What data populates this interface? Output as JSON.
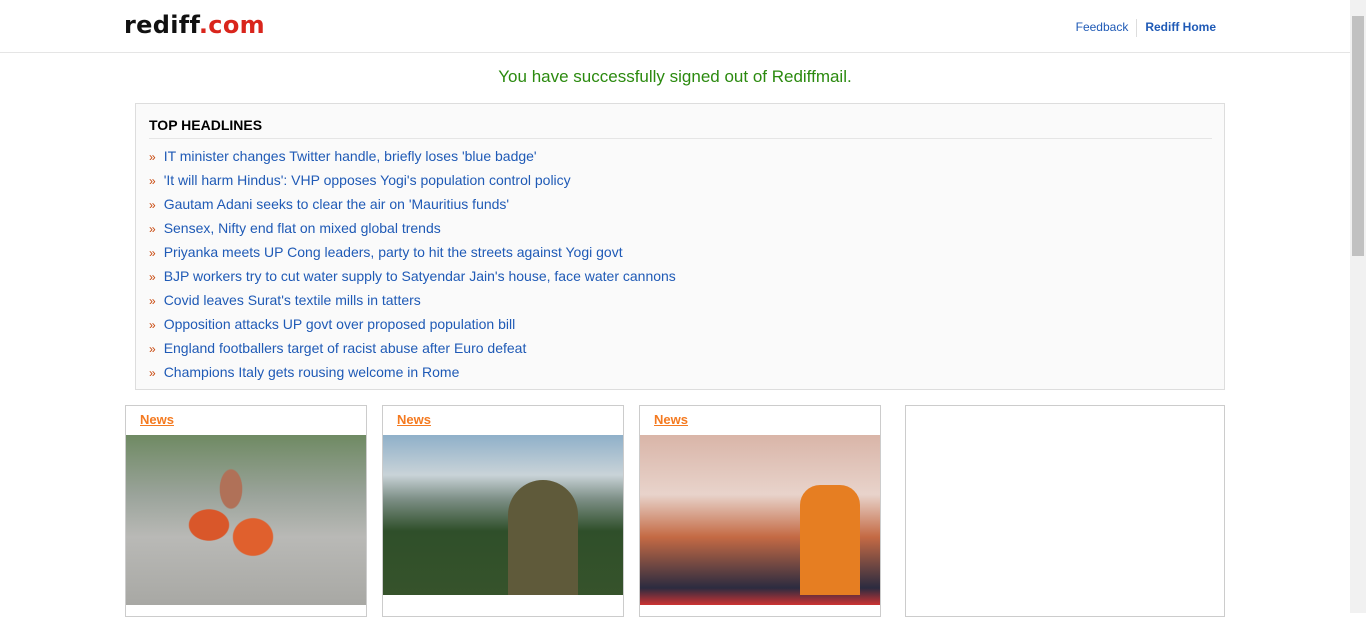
{
  "header": {
    "logo_left": "rediff",
    "logo_right": ".com",
    "feedback": "Feedback",
    "home": "Rediff Home"
  },
  "message": "You have successfully signed out of Rediffmail.",
  "headlines": {
    "title": "TOP HEADLINES",
    "bullet": "»",
    "items": [
      "IT minister changes Twitter handle, briefly loses 'blue badge'",
      "'It will harm Hindus': VHP opposes Yogi's population control policy",
      "Gautam Adani seeks to clear the air on 'Mauritius funds'",
      "Sensex, Nifty end flat on mixed global trends",
      "Priyanka meets UP Cong leaders, party to hit the streets against Yogi govt",
      "BJP workers try to cut water supply to Satyendar Jain's house, face water cannons",
      "Covid leaves Surat's textile mills in tatters",
      "Opposition attacks UP govt over proposed population bill",
      "England footballers target of racist abuse after Euro defeat",
      "Champions Italy gets rousing welcome in Rome"
    ]
  },
  "cards": [
    {
      "label": "News"
    },
    {
      "label": "News"
    },
    {
      "label": "News"
    }
  ]
}
